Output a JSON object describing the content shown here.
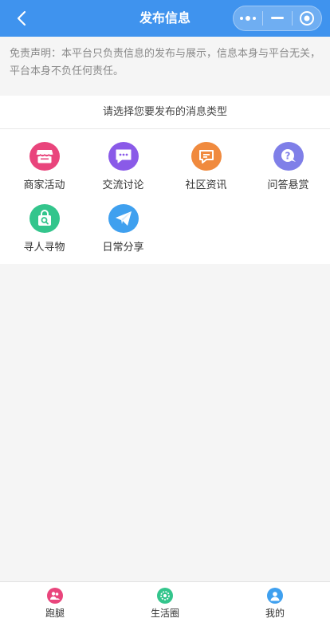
{
  "header": {
    "title": "发布信息",
    "accent": "#3f93ee",
    "back_icon": "chevron-left-icon",
    "menu_icons": [
      "more-dots-icon",
      "minimize-icon",
      "close-circle-icon"
    ]
  },
  "disclaimer": {
    "text": "免责声明：本平台只负责信息的发布与展示，信息本身与平台无关，平台本身不负任何责任。"
  },
  "panel": {
    "heading": "请选择您要发布的消息类型",
    "categories": [
      {
        "label": "商家活动",
        "icon": "storefront-icon",
        "color": "#e9457c"
      },
      {
        "label": "交流讨论",
        "icon": "chat-bubble-icon",
        "color": "#8a5ae8"
      },
      {
        "label": "社区资讯",
        "icon": "news-message-icon",
        "color": "#f08a3e"
      },
      {
        "label": "问答悬赏",
        "icon": "question-bubble-icon",
        "color": "#7f7fe8"
      },
      {
        "label": "寻人寻物",
        "icon": "search-bag-icon",
        "color": "#33c58c"
      },
      {
        "label": "日常分享",
        "icon": "paper-plane-icon",
        "color": "#3fa0ef"
      }
    ]
  },
  "tabbar": {
    "tabs": [
      {
        "label": "跑腿",
        "icon": "errand-people-icon",
        "color": "#e9457c"
      },
      {
        "label": "生活圈",
        "icon": "life-circle-icon",
        "color": "#33c58c"
      },
      {
        "label": "我的",
        "icon": "profile-icon",
        "color": "#3fa0ef"
      }
    ]
  }
}
